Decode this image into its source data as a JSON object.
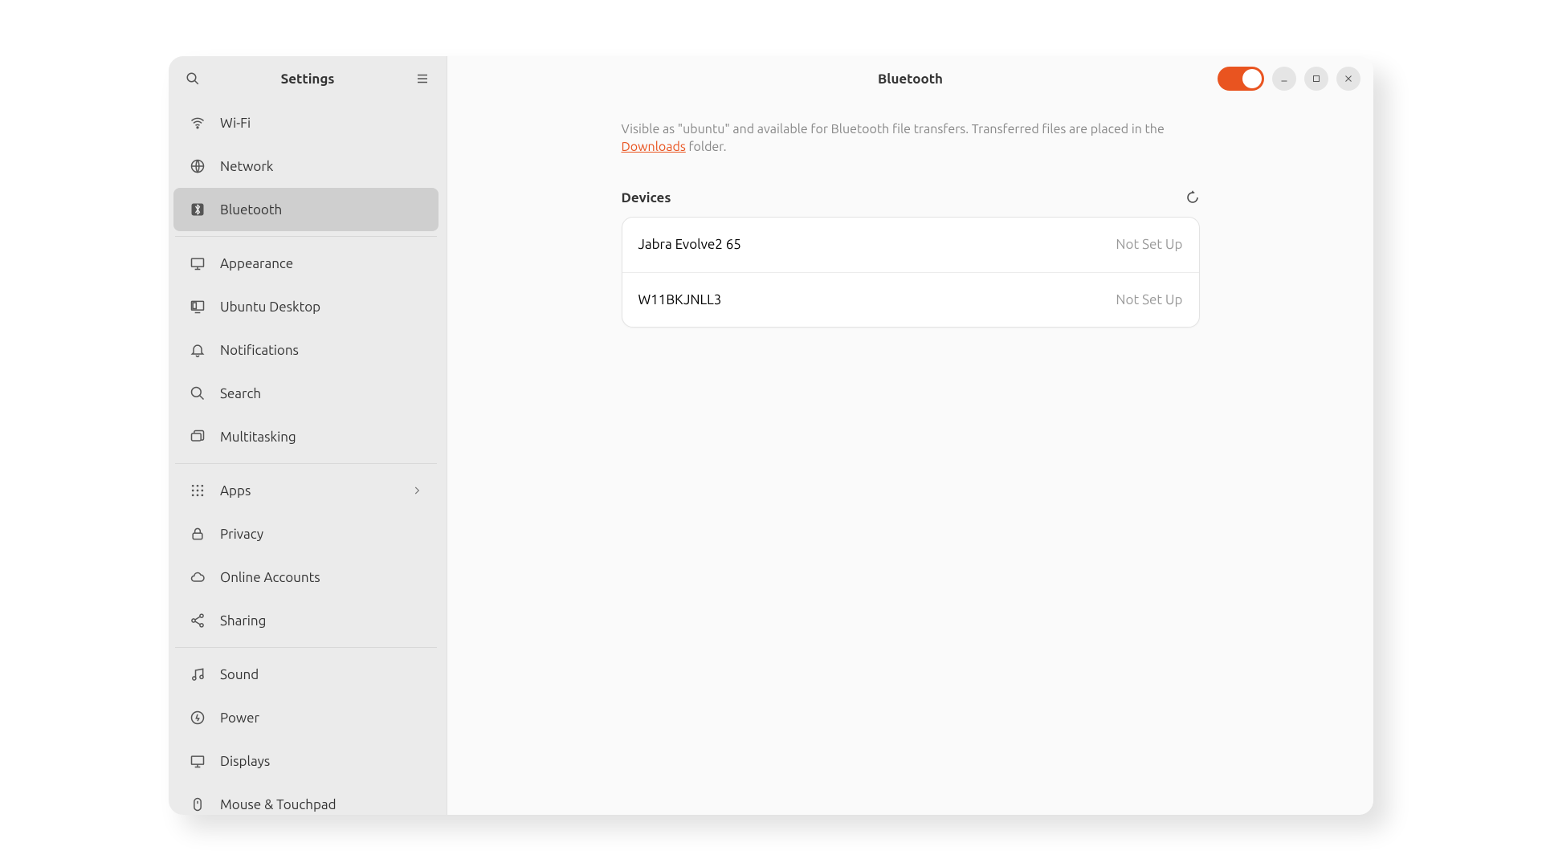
{
  "sidebar": {
    "title": "Settings",
    "items": [
      {
        "label": "Wi-Fi"
      },
      {
        "label": "Network"
      },
      {
        "label": "Bluetooth"
      },
      {
        "label": "Appearance"
      },
      {
        "label": "Ubuntu Desktop"
      },
      {
        "label": "Notifications"
      },
      {
        "label": "Search"
      },
      {
        "label": "Multitasking"
      },
      {
        "label": "Apps"
      },
      {
        "label": "Privacy"
      },
      {
        "label": "Online Accounts"
      },
      {
        "label": "Sharing"
      },
      {
        "label": "Sound"
      },
      {
        "label": "Power"
      },
      {
        "label": "Displays"
      },
      {
        "label": "Mouse & Touchpad"
      }
    ]
  },
  "main": {
    "title": "Bluetooth",
    "toggle_on": true,
    "description_pre": "Visible as \"ubuntu\" and available for Bluetooth file transfers. Transferred files are placed in the ",
    "description_link": "Downloads",
    "description_post": " folder.",
    "devices_label": "Devices",
    "devices": [
      {
        "name": "Jabra Evolve2 65",
        "status": "Not Set Up"
      },
      {
        "name": "W11BKJNLL3",
        "status": "Not Set Up"
      }
    ]
  },
  "colors": {
    "accent": "#e95420"
  }
}
